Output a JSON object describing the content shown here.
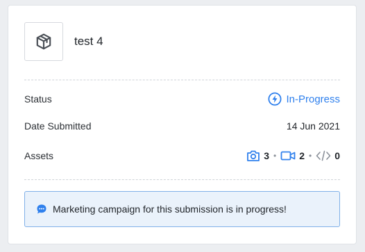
{
  "submission": {
    "title": "test 4",
    "thumbnail_icon": "package-icon"
  },
  "details": {
    "status_label": "Status",
    "status_value": "In-Progress",
    "status_icon": "lightning-icon",
    "status_color": "#2f80ed",
    "date_label": "Date Submitted",
    "date_value": "14 Jun 2021",
    "assets_label": "Assets",
    "assets": [
      {
        "icon": "camera-icon",
        "count": "3"
      },
      {
        "icon": "video-icon",
        "count": "2"
      },
      {
        "icon": "code-icon",
        "count": "0"
      }
    ],
    "assets_separator": "•"
  },
  "notice": {
    "icon": "chat-bubble-icon",
    "text": "Marketing campaign for this submission is in progress!"
  }
}
